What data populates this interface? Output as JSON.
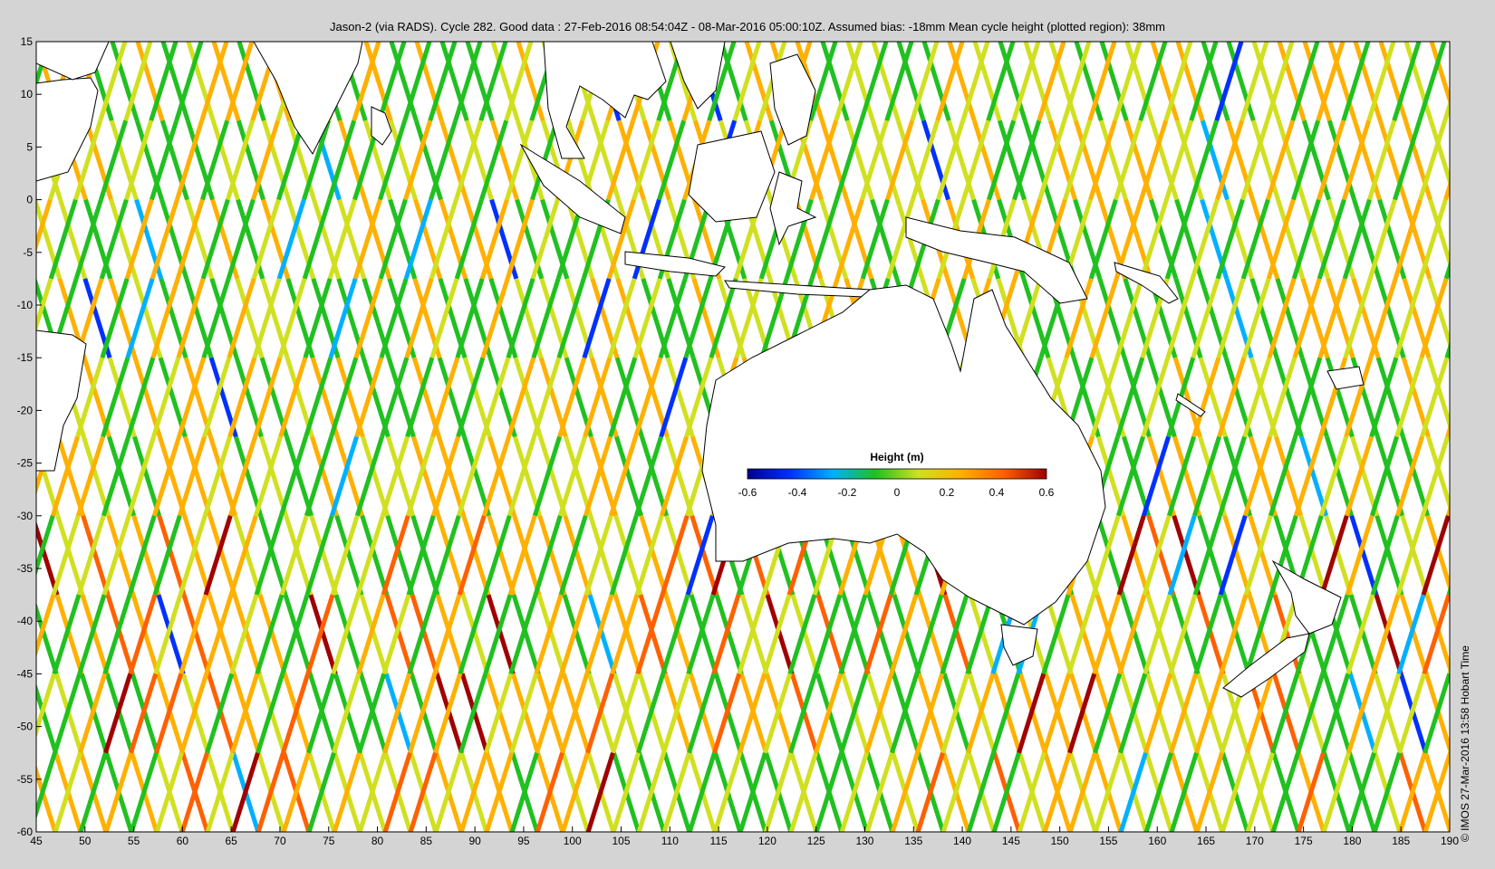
{
  "title": "Jason-2 (via RADS). Cycle 282. Good data : 27-Feb-2016 08:54:04Z - 08-Mar-2016 05:00:10Z. Assumed bias: -18mm  Mean cycle height (plotted region): 38mm",
  "credit": "© IMOS 27-Mar-2016 13:58 Hobart Time",
  "x_ticks": [
    "45",
    "50",
    "55",
    "60",
    "65",
    "70",
    "75",
    "80",
    "85",
    "90",
    "95",
    "100",
    "105",
    "110",
    "115",
    "120",
    "125",
    "130",
    "135",
    "140",
    "145",
    "150",
    "155",
    "160",
    "165",
    "170",
    "175",
    "180",
    "185",
    "190"
  ],
  "y_ticks": [
    "15",
    "10",
    "5",
    "0",
    "-5",
    "-10",
    "-15",
    "-20",
    "-25",
    "-30",
    "-35",
    "-40",
    "-45",
    "-50",
    "-55",
    "-60"
  ],
  "colorbar": {
    "title": "Height (m)",
    "ticks": [
      "-0.6",
      "-0.4",
      "-0.2",
      "0",
      "0.2",
      "0.4",
      "0.6"
    ],
    "range": [
      -0.6,
      0.6
    ],
    "colors": [
      "#00008f",
      "#0030ff",
      "#00b0ff",
      "#20c020",
      "#d0e020",
      "#ffb000",
      "#ff6000",
      "#a00000"
    ]
  },
  "map_extent": {
    "lon": [
      45,
      190
    ],
    "lat": [
      -60,
      15
    ]
  },
  "colors": {
    "background": "#d4d4d4",
    "land": "#ffffff",
    "coast": "#000000"
  }
}
